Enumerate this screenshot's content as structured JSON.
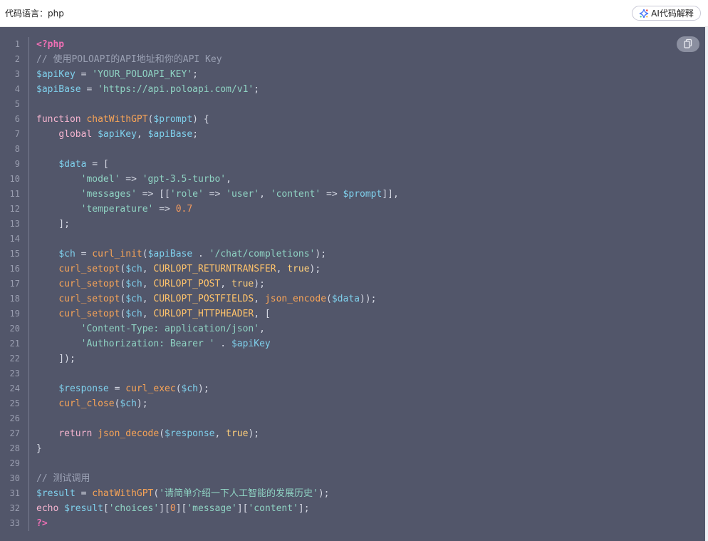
{
  "header": {
    "language_label": "代码语言：php",
    "ai_button_label": "AI代码解释"
  },
  "colors": {
    "code_background": "#52566a",
    "php_tag": "#ee6fb4",
    "keyword": "#f5b4cf",
    "variable": "#7fd0ec",
    "string": "#8fd3c3",
    "function": "#f8a457",
    "constant": "#ffc36b",
    "number": "#f59b5e",
    "comment": "#9aa0b3"
  },
  "icons": {
    "ai": "ai-sparkle-icon",
    "copy": "copy-icon"
  },
  "code": {
    "language": "php",
    "lines": [
      [
        {
          "t": "tag",
          "v": "<?php"
        }
      ],
      [
        {
          "t": "cmt",
          "v": "// 使用POLOAPI的API地址和你的API Key"
        }
      ],
      [
        {
          "t": "var",
          "v": "$apiKey"
        },
        {
          "t": "op",
          "v": " = "
        },
        {
          "t": "str",
          "v": "'YOUR_POLOAPI_KEY'"
        },
        {
          "t": "pun",
          "v": ";"
        }
      ],
      [
        {
          "t": "var",
          "v": "$apiBase"
        },
        {
          "t": "op",
          "v": " = "
        },
        {
          "t": "str",
          "v": "'https://api.poloapi.com/v1'"
        },
        {
          "t": "pun",
          "v": ";"
        }
      ],
      [],
      [
        {
          "t": "kw",
          "v": "function"
        },
        {
          "t": "pun",
          "v": " "
        },
        {
          "t": "fn",
          "v": "chatWithGPT"
        },
        {
          "t": "pun",
          "v": "("
        },
        {
          "t": "var",
          "v": "$prompt"
        },
        {
          "t": "pun",
          "v": ") {"
        }
      ],
      [
        {
          "t": "pun",
          "v": "    "
        },
        {
          "t": "kw",
          "v": "global"
        },
        {
          "t": "pun",
          "v": " "
        },
        {
          "t": "var",
          "v": "$apiKey"
        },
        {
          "t": "pun",
          "v": ", "
        },
        {
          "t": "var",
          "v": "$apiBase"
        },
        {
          "t": "pun",
          "v": ";"
        }
      ],
      [],
      [
        {
          "t": "pun",
          "v": "    "
        },
        {
          "t": "var",
          "v": "$data"
        },
        {
          "t": "op",
          "v": " = "
        },
        {
          "t": "pun",
          "v": "["
        }
      ],
      [
        {
          "t": "pun",
          "v": "        "
        },
        {
          "t": "str",
          "v": "'model'"
        },
        {
          "t": "op",
          "v": " => "
        },
        {
          "t": "str",
          "v": "'gpt-3.5-turbo'"
        },
        {
          "t": "pun",
          "v": ","
        }
      ],
      [
        {
          "t": "pun",
          "v": "        "
        },
        {
          "t": "str",
          "v": "'messages'"
        },
        {
          "t": "op",
          "v": " => "
        },
        {
          "t": "pun",
          "v": "[["
        },
        {
          "t": "str",
          "v": "'role'"
        },
        {
          "t": "op",
          "v": " => "
        },
        {
          "t": "str",
          "v": "'user'"
        },
        {
          "t": "pun",
          "v": ", "
        },
        {
          "t": "str",
          "v": "'content'"
        },
        {
          "t": "op",
          "v": " => "
        },
        {
          "t": "var",
          "v": "$prompt"
        },
        {
          "t": "pun",
          "v": "]],"
        }
      ],
      [
        {
          "t": "pun",
          "v": "        "
        },
        {
          "t": "str",
          "v": "'temperature'"
        },
        {
          "t": "op",
          "v": " => "
        },
        {
          "t": "num",
          "v": "0.7"
        }
      ],
      [
        {
          "t": "pun",
          "v": "    ];"
        }
      ],
      [],
      [
        {
          "t": "pun",
          "v": "    "
        },
        {
          "t": "var",
          "v": "$ch"
        },
        {
          "t": "op",
          "v": " = "
        },
        {
          "t": "fn",
          "v": "curl_init"
        },
        {
          "t": "pun",
          "v": "("
        },
        {
          "t": "var",
          "v": "$apiBase"
        },
        {
          "t": "op",
          "v": " . "
        },
        {
          "t": "str",
          "v": "'/chat/completions'"
        },
        {
          "t": "pun",
          "v": ");"
        }
      ],
      [
        {
          "t": "pun",
          "v": "    "
        },
        {
          "t": "fn",
          "v": "curl_setopt"
        },
        {
          "t": "pun",
          "v": "("
        },
        {
          "t": "var",
          "v": "$ch"
        },
        {
          "t": "pun",
          "v": ", "
        },
        {
          "t": "const",
          "v": "CURLOPT_RETURNTRANSFER"
        },
        {
          "t": "pun",
          "v": ", "
        },
        {
          "t": "bool",
          "v": "true"
        },
        {
          "t": "pun",
          "v": ");"
        }
      ],
      [
        {
          "t": "pun",
          "v": "    "
        },
        {
          "t": "fn",
          "v": "curl_setopt"
        },
        {
          "t": "pun",
          "v": "("
        },
        {
          "t": "var",
          "v": "$ch"
        },
        {
          "t": "pun",
          "v": ", "
        },
        {
          "t": "const",
          "v": "CURLOPT_POST"
        },
        {
          "t": "pun",
          "v": ", "
        },
        {
          "t": "bool",
          "v": "true"
        },
        {
          "t": "pun",
          "v": ");"
        }
      ],
      [
        {
          "t": "pun",
          "v": "    "
        },
        {
          "t": "fn",
          "v": "curl_setopt"
        },
        {
          "t": "pun",
          "v": "("
        },
        {
          "t": "var",
          "v": "$ch"
        },
        {
          "t": "pun",
          "v": ", "
        },
        {
          "t": "const",
          "v": "CURLOPT_POSTFIELDS"
        },
        {
          "t": "pun",
          "v": ", "
        },
        {
          "t": "fn",
          "v": "json_encode"
        },
        {
          "t": "pun",
          "v": "("
        },
        {
          "t": "var",
          "v": "$data"
        },
        {
          "t": "pun",
          "v": "));"
        }
      ],
      [
        {
          "t": "pun",
          "v": "    "
        },
        {
          "t": "fn",
          "v": "curl_setopt"
        },
        {
          "t": "pun",
          "v": "("
        },
        {
          "t": "var",
          "v": "$ch"
        },
        {
          "t": "pun",
          "v": ", "
        },
        {
          "t": "const",
          "v": "CURLOPT_HTTPHEADER"
        },
        {
          "t": "pun",
          "v": ", ["
        }
      ],
      [
        {
          "t": "pun",
          "v": "        "
        },
        {
          "t": "str",
          "v": "'Content-Type: application/json'"
        },
        {
          "t": "pun",
          "v": ","
        }
      ],
      [
        {
          "t": "pun",
          "v": "        "
        },
        {
          "t": "str",
          "v": "'Authorization: Bearer '"
        },
        {
          "t": "op",
          "v": " . "
        },
        {
          "t": "var",
          "v": "$apiKey"
        }
      ],
      [
        {
          "t": "pun",
          "v": "    ]);"
        }
      ],
      [],
      [
        {
          "t": "pun",
          "v": "    "
        },
        {
          "t": "var",
          "v": "$response"
        },
        {
          "t": "op",
          "v": " = "
        },
        {
          "t": "fn",
          "v": "curl_exec"
        },
        {
          "t": "pun",
          "v": "("
        },
        {
          "t": "var",
          "v": "$ch"
        },
        {
          "t": "pun",
          "v": ");"
        }
      ],
      [
        {
          "t": "pun",
          "v": "    "
        },
        {
          "t": "fn",
          "v": "curl_close"
        },
        {
          "t": "pun",
          "v": "("
        },
        {
          "t": "var",
          "v": "$ch"
        },
        {
          "t": "pun",
          "v": ");"
        }
      ],
      [],
      [
        {
          "t": "pun",
          "v": "    "
        },
        {
          "t": "kw",
          "v": "return"
        },
        {
          "t": "pun",
          "v": " "
        },
        {
          "t": "fn",
          "v": "json_decode"
        },
        {
          "t": "pun",
          "v": "("
        },
        {
          "t": "var",
          "v": "$response"
        },
        {
          "t": "pun",
          "v": ", "
        },
        {
          "t": "bool",
          "v": "true"
        },
        {
          "t": "pun",
          "v": ");"
        }
      ],
      [
        {
          "t": "pun",
          "v": "}"
        }
      ],
      [],
      [
        {
          "t": "cmt",
          "v": "// 测试调用"
        }
      ],
      [
        {
          "t": "var",
          "v": "$result"
        },
        {
          "t": "op",
          "v": " = "
        },
        {
          "t": "fn",
          "v": "chatWithGPT"
        },
        {
          "t": "pun",
          "v": "("
        },
        {
          "t": "str",
          "v": "'请简单介绍一下人工智能的发展历史'"
        },
        {
          "t": "pun",
          "v": ");"
        }
      ],
      [
        {
          "t": "kw",
          "v": "echo"
        },
        {
          "t": "pun",
          "v": " "
        },
        {
          "t": "var",
          "v": "$result"
        },
        {
          "t": "pun",
          "v": "["
        },
        {
          "t": "str",
          "v": "'choices'"
        },
        {
          "t": "pun",
          "v": "]["
        },
        {
          "t": "num",
          "v": "0"
        },
        {
          "t": "pun",
          "v": "]["
        },
        {
          "t": "str",
          "v": "'message'"
        },
        {
          "t": "pun",
          "v": "]["
        },
        {
          "t": "str",
          "v": "'content'"
        },
        {
          "t": "pun",
          "v": "];"
        }
      ],
      [
        {
          "t": "tag",
          "v": "?>"
        }
      ]
    ]
  }
}
